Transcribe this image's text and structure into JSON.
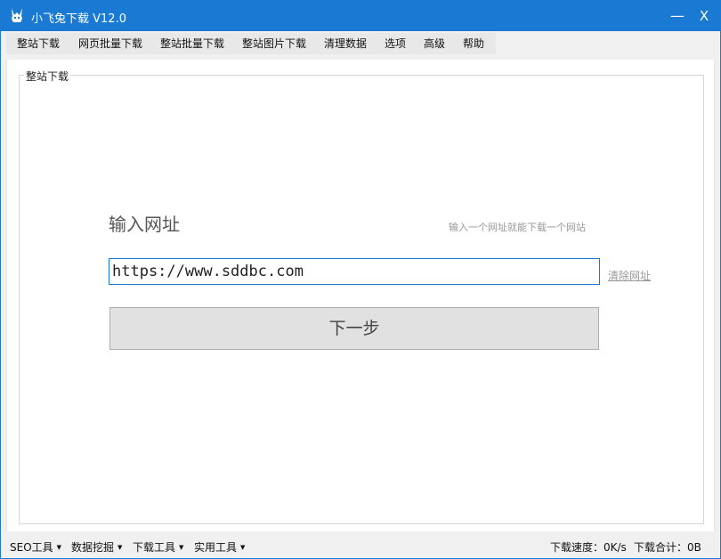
{
  "window": {
    "title": "小飞兔下载 V12.0",
    "minimize_label": "—",
    "close_label": "X"
  },
  "menu": {
    "items": [
      "整站下载",
      "网页批量下载",
      "整站批量下载",
      "整站图片下载",
      "清理数据",
      "选项",
      "高级",
      "帮助"
    ]
  },
  "group": {
    "title": "整站下载"
  },
  "form": {
    "heading": "输入网址",
    "hint": "输入一个网址就能下载一个网站",
    "url_value": "https://www.sddbc.com",
    "clear_label": "清除网址",
    "next_label": "下一步"
  },
  "statusbar": {
    "menus": [
      "SEO工具",
      "数据挖掘",
      "下载工具",
      "实用工具"
    ],
    "speed": "下载速度：0K/s",
    "total": "下载合计：0B"
  },
  "colors": {
    "accent": "#1a79d2",
    "background": "#f0f0f0",
    "button": "#e1e1e1"
  }
}
